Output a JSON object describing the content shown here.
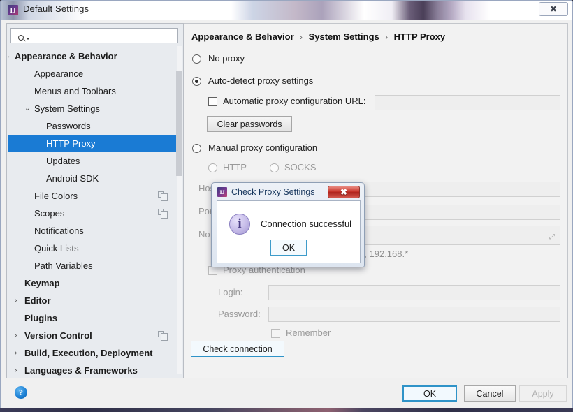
{
  "window": {
    "title": "Default Settings",
    "icon": "intellij-logo-icon",
    "close_label": "✖"
  },
  "sidebar": {
    "search": {
      "placeholder": "",
      "value": "",
      "icon": "search-icon"
    },
    "items": [
      {
        "label": "Appearance & Behavior",
        "indent": 10,
        "bold": true,
        "chevron": "⌄",
        "selected": false,
        "icon": null
      },
      {
        "label": "Appearance",
        "indent": 38,
        "bold": false,
        "chevron": "",
        "selected": false,
        "icon": null
      },
      {
        "label": "Menus and Toolbars",
        "indent": 38,
        "bold": false,
        "chevron": "",
        "selected": false,
        "icon": null
      },
      {
        "label": "System Settings",
        "indent": 38,
        "bold": false,
        "chevron": "⌄",
        "selected": false,
        "icon": null
      },
      {
        "label": "Passwords",
        "indent": 55,
        "bold": false,
        "chevron": "",
        "selected": false,
        "icon": null
      },
      {
        "label": "HTTP Proxy",
        "indent": 55,
        "bold": false,
        "chevron": "",
        "selected": true,
        "icon": null
      },
      {
        "label": "Updates",
        "indent": 55,
        "bold": false,
        "chevron": "",
        "selected": false,
        "icon": null
      },
      {
        "label": "Android SDK",
        "indent": 55,
        "bold": false,
        "chevron": "",
        "selected": false,
        "icon": null
      },
      {
        "label": "File Colors",
        "indent": 38,
        "bold": false,
        "chevron": "",
        "selected": false,
        "icon": "copy-icon"
      },
      {
        "label": "Scopes",
        "indent": 38,
        "bold": false,
        "chevron": "",
        "selected": false,
        "icon": "copy-icon"
      },
      {
        "label": "Notifications",
        "indent": 38,
        "bold": false,
        "chevron": "",
        "selected": false,
        "icon": null
      },
      {
        "label": "Quick Lists",
        "indent": 38,
        "bold": false,
        "chevron": "",
        "selected": false,
        "icon": null
      },
      {
        "label": "Path Variables",
        "indent": 38,
        "bold": false,
        "chevron": "",
        "selected": false,
        "icon": null
      },
      {
        "label": "Keymap",
        "indent": 24,
        "bold": true,
        "chevron": "",
        "selected": false,
        "icon": null
      },
      {
        "label": "Editor",
        "indent": 24,
        "bold": true,
        "chevron": "›",
        "selected": false,
        "icon": null
      },
      {
        "label": "Plugins",
        "indent": 24,
        "bold": true,
        "chevron": "",
        "selected": false,
        "icon": null
      },
      {
        "label": "Version Control",
        "indent": 24,
        "bold": true,
        "chevron": "›",
        "selected": false,
        "icon": "copy-icon"
      },
      {
        "label": "Build, Execution, Deployment",
        "indent": 24,
        "bold": true,
        "chevron": "›",
        "selected": false,
        "icon": null
      },
      {
        "label": "Languages & Frameworks",
        "indent": 24,
        "bold": true,
        "chevron": "›",
        "selected": false,
        "icon": null
      }
    ]
  },
  "main": {
    "breadcrumb": {
      "part1": "Appearance & Behavior",
      "sep1": "›",
      "part2": "System Settings",
      "sep2": "›",
      "part3": "HTTP Proxy"
    },
    "no_proxy_label": "No proxy",
    "auto_detect_label": "Auto-detect proxy settings",
    "auto_config_url_label": "Automatic proxy configuration URL:",
    "auto_config_url_value": "",
    "clear_passwords_label": "Clear passwords",
    "manual_label": "Manual proxy configuration",
    "http_label": "HTTP",
    "socks_label": "SOCKS",
    "host_label": "Host name:",
    "host_value": "",
    "port_label": "Port number:",
    "port_value": "",
    "no_proxy_for_label": "No proxy for:",
    "no_proxy_for_value": "",
    "example_text": "Example: *.domain.com, 192.168.*",
    "proxy_auth_label": "Proxy authentication",
    "login_label": "Login:",
    "login_value": "",
    "password_label": "Password:",
    "password_value": "",
    "remember_label": "Remember",
    "check_connection_label": "Check connection"
  },
  "modal": {
    "title": "Check Proxy Settings",
    "icon": "intellij-logo-icon",
    "close_label": "✖",
    "message": "Connection successful",
    "info_icon": "info-icon",
    "ok_label": "OK"
  },
  "footer": {
    "help_label": "?",
    "ok_label": "OK",
    "cancel_label": "Cancel",
    "apply_label": "Apply"
  },
  "colors": {
    "selection_blue": "#1a7bd4",
    "focus_blue": "#2f93c8",
    "panel_bg": "#f2f2f2",
    "sidebar_bg": "#e8ebef"
  }
}
